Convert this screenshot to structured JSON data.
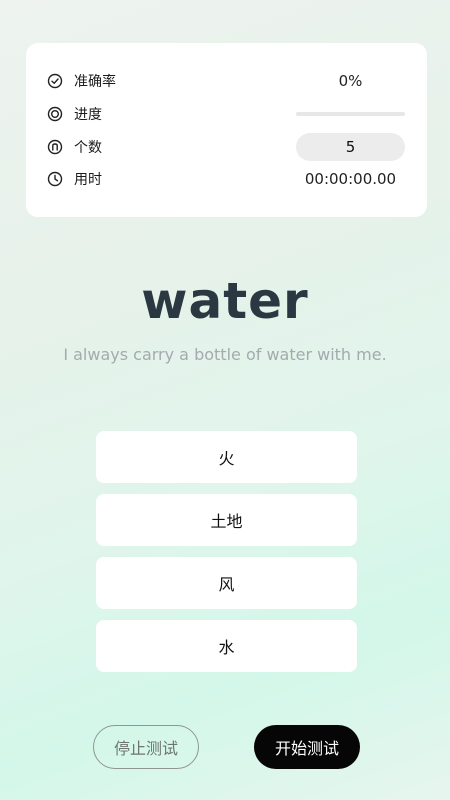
{
  "stats": {
    "accuracy_label": "准确率",
    "accuracy_value": "0%",
    "progress_label": "进度",
    "progress_fraction": 0,
    "count_label": "个数",
    "count_value": "5",
    "time_label": "用时",
    "time_value": "00:00:00.00",
    "icons": [
      "check-circle-icon",
      "ring-icon",
      "n-circle-icon",
      "clock-icon"
    ]
  },
  "quiz": {
    "word": "water",
    "sentence": "I always carry a bottle of water with me.",
    "options": [
      "火",
      "土地",
      "风",
      "水"
    ]
  },
  "actions": {
    "stop_label": "停止测试",
    "start_label": "开始测试"
  },
  "colors": {
    "word": "#2b3842",
    "start_button": "#060606",
    "card": "#ffffff"
  }
}
